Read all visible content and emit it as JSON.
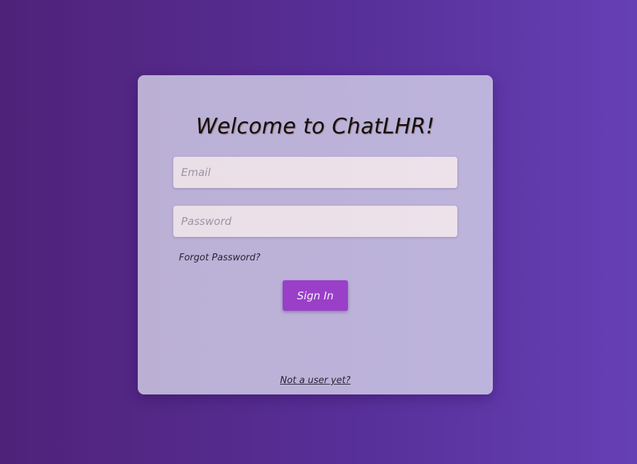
{
  "login": {
    "title": "Welcome to ChatLHR!",
    "email": {
      "placeholder": "Email",
      "value": ""
    },
    "password": {
      "placeholder": "Password",
      "value": ""
    },
    "forgot_password_label": "Forgot Password?",
    "sign_in_label": "Sign In",
    "register_label": "Not a user yet?"
  },
  "colors": {
    "background_start": "#4f2279",
    "background_end": "#6540b5",
    "card": "#bdb4dd",
    "input": "#ece0e8",
    "button": "#9a3fc8"
  }
}
